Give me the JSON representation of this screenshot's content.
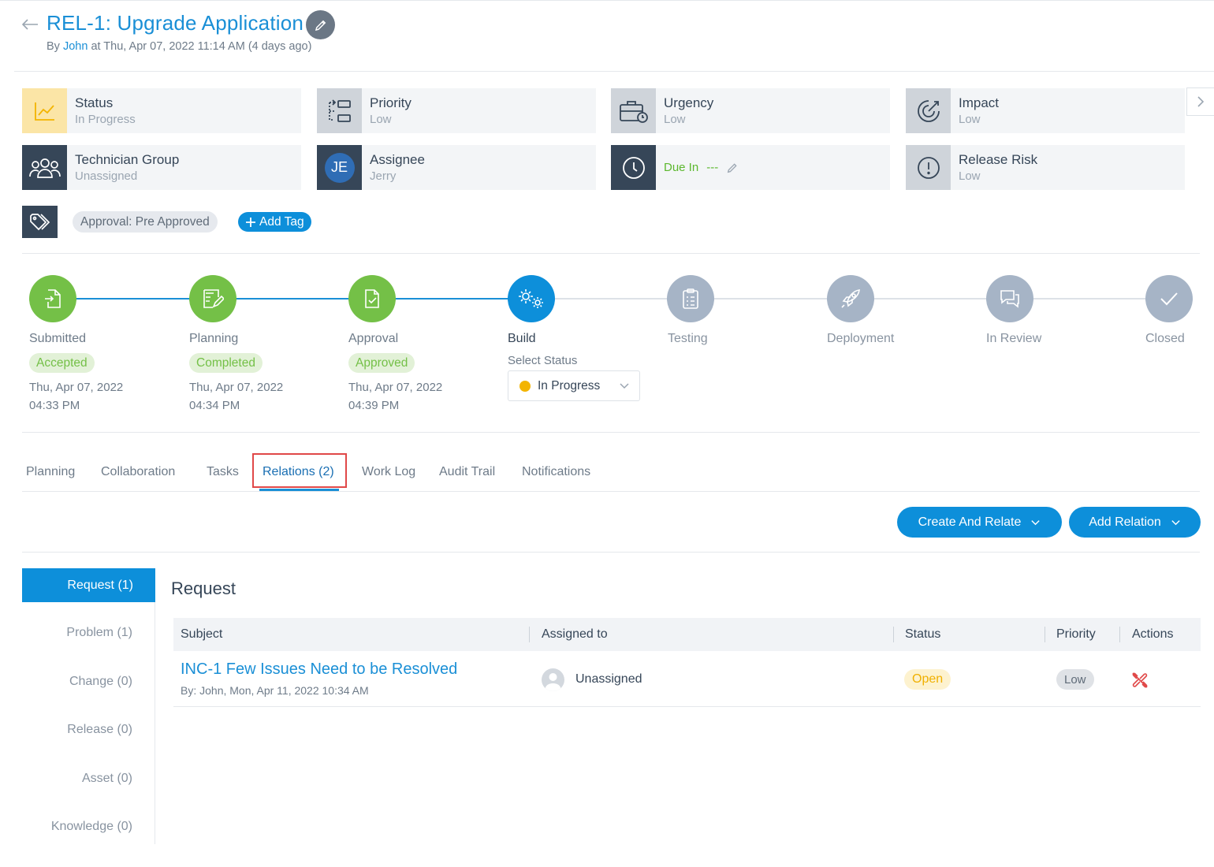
{
  "header": {
    "title": "REL-1: Upgrade Application",
    "by_prefix": "By",
    "author": "John",
    "at_text": "at Thu, Apr 07, 2022 11:14 AM (4 days ago)"
  },
  "summary_cards": {
    "status": {
      "label": "Status",
      "value": "In Progress",
      "icon": "trend-chart-icon"
    },
    "priority": {
      "label": "Priority",
      "value": "Low",
      "icon": "priority-flow-icon"
    },
    "urgency": {
      "label": "Urgency",
      "value": "Low",
      "icon": "briefcase-clock-icon"
    },
    "impact": {
      "label": "Impact",
      "value": "Low",
      "icon": "target-icon"
    },
    "technician_group": {
      "label": "Technician Group",
      "value": "Unassigned",
      "icon": "users-icon"
    },
    "assignee": {
      "label": "Assignee",
      "value": "Jerry",
      "initials": "JE"
    },
    "due": {
      "label": "Due In",
      "value": "---",
      "icon": "clock-icon"
    },
    "release_risk": {
      "label": "Release Risk",
      "value": "Low",
      "icon": "exclamation-circle-icon"
    }
  },
  "tags": {
    "items": [
      "Approval: Pre Approved"
    ],
    "add_label": "Add Tag"
  },
  "stepper": {
    "steps": [
      {
        "name": "Submitted",
        "badge": "Accepted",
        "date": "Thu, Apr 07, 2022",
        "time": "04:33 PM",
        "state": "done"
      },
      {
        "name": "Planning",
        "badge": "Completed",
        "date": "Thu, Apr 07, 2022",
        "time": "04:34 PM",
        "state": "done"
      },
      {
        "name": "Approval",
        "badge": "Approved",
        "date": "Thu, Apr 07, 2022",
        "time": "04:39 PM",
        "state": "done"
      },
      {
        "name": "Build",
        "state": "current"
      },
      {
        "name": "Testing",
        "state": "pending"
      },
      {
        "name": "Deployment",
        "state": "pending"
      },
      {
        "name": "In Review",
        "state": "pending"
      },
      {
        "name": "Closed",
        "state": "pending"
      }
    ],
    "select_label": "Select Status",
    "select_value": "In Progress"
  },
  "tabs": [
    {
      "label": "Planning"
    },
    {
      "label": "Collaboration"
    },
    {
      "label": "Tasks"
    },
    {
      "label": "Relations (2)",
      "active": true
    },
    {
      "label": "Work Log"
    },
    {
      "label": "Audit Trail"
    },
    {
      "label": "Notifications"
    }
  ],
  "actions": {
    "create_and_relate": "Create And Relate",
    "add_relation": "Add Relation"
  },
  "relation_nav": [
    {
      "label": "Request (1)",
      "active": true
    },
    {
      "label": "Problem (1)"
    },
    {
      "label": "Change (0)"
    },
    {
      "label": "Release (0)"
    },
    {
      "label": "Asset (0)"
    },
    {
      "label": "Knowledge (0)"
    }
  ],
  "relations_table": {
    "section_title": "Request",
    "columns": [
      "Subject",
      "Assigned to",
      "Status",
      "Priority",
      "Actions"
    ],
    "rows": [
      {
        "subject": "INC-1 Few Issues Need to be Resolved",
        "meta": "By: John, Mon, Apr 11, 2022 10:34 AM",
        "assigned_to": "Unassigned",
        "status": "Open",
        "priority": "Low"
      }
    ]
  },
  "colors": {
    "primary": "#0d8fda",
    "link": "#1a8fd6",
    "success": "#74c047",
    "pending": "#a6b4c6",
    "dark": "#364658",
    "danger": "#e04848",
    "warning": "#f3b400"
  }
}
